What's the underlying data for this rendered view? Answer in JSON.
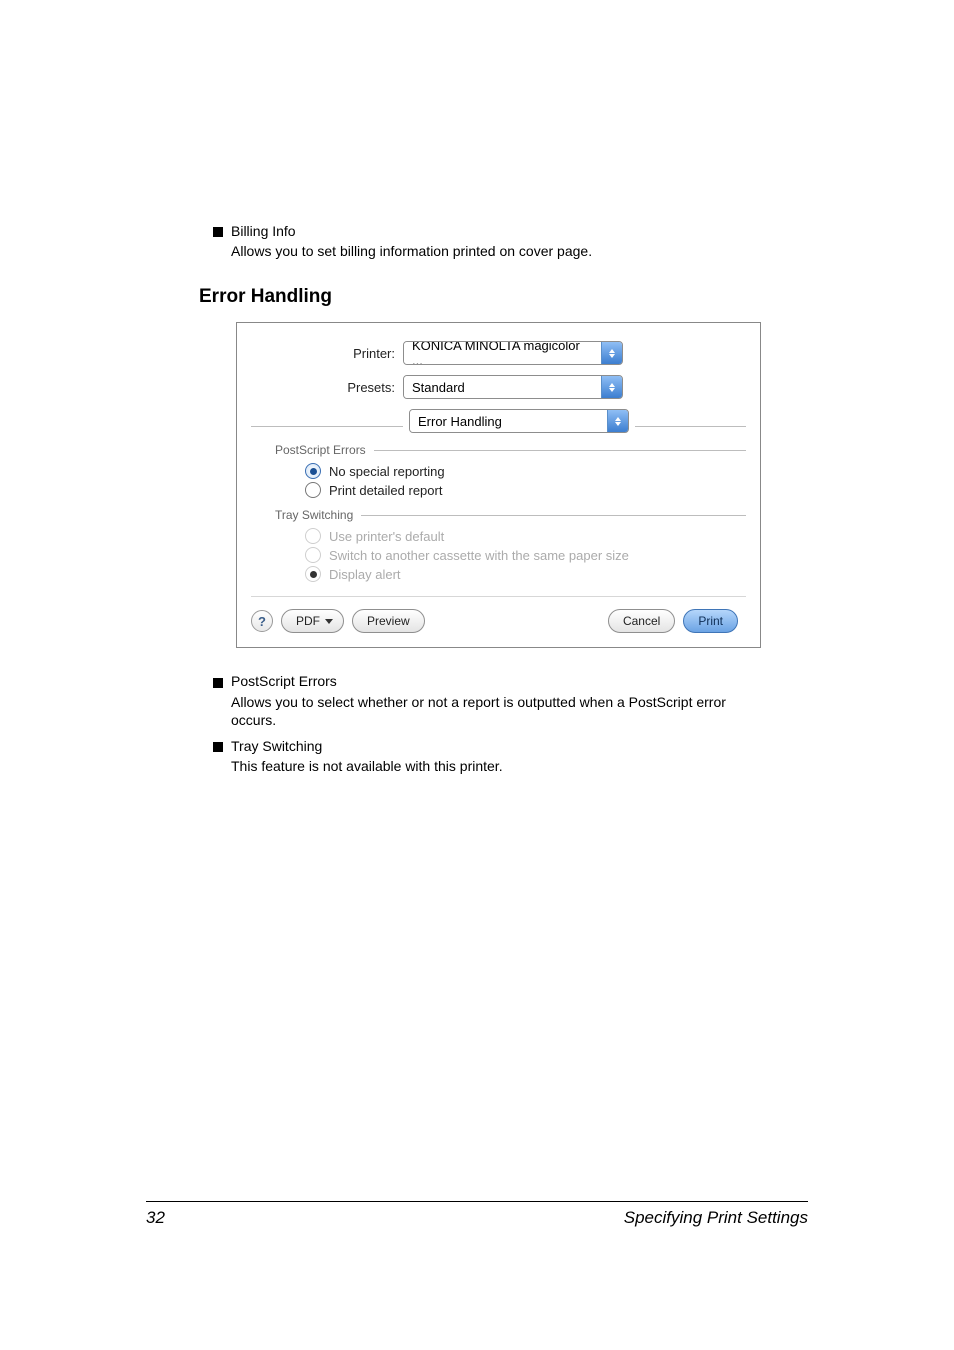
{
  "bullets": {
    "billing": {
      "title": "Billing Info",
      "desc": "Allows you to set billing information printed on cover page."
    },
    "postscript": {
      "title": "PostScript Errors",
      "desc": "Allows you to select whether or not a report is outputted when a PostScript error occurs."
    },
    "tray": {
      "title": "Tray Switching",
      "desc": "This feature is not available with this printer."
    }
  },
  "heading": "Error Handling",
  "dialog": {
    "printerLabel": "Printer:",
    "printerValue": "KONICA MINOLTA magicolor ...",
    "presetsLabel": "Presets:",
    "presetsValue": "Standard",
    "paneValue": "Error Handling",
    "group1": "PostScript Errors",
    "opt_nospecial": "No special reporting",
    "opt_detailed": "Print detailed report",
    "group2": "Tray Switching",
    "opt_usedefault": "Use printer's default",
    "opt_switch": "Switch to another cassette with the same paper size",
    "opt_display": "Display alert",
    "help": "?",
    "pdf": "PDF",
    "preview": "Preview",
    "cancel": "Cancel",
    "print": "Print"
  },
  "footer": {
    "pageNum": "32",
    "section": "Specifying Print Settings"
  }
}
